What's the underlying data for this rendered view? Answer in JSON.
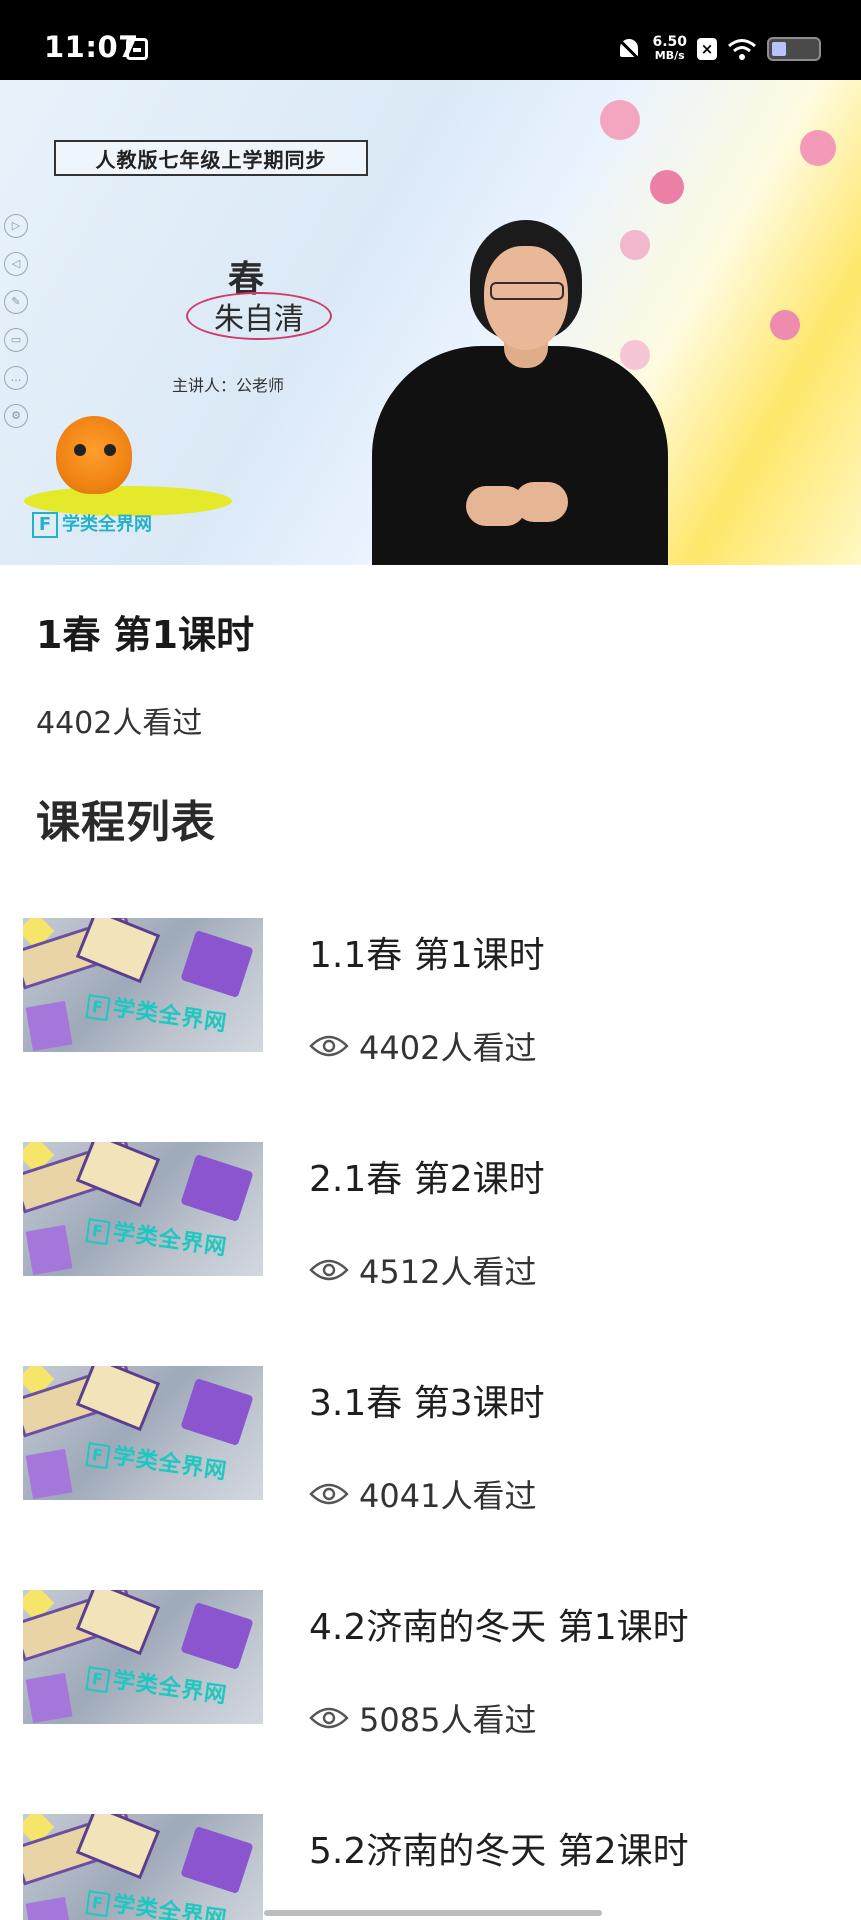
{
  "status_bar": {
    "time": "11:07",
    "net_speed_value": "6.50",
    "net_speed_unit": "MB/s",
    "x_badge": "×",
    "icons": [
      "app-notification-icon",
      "bell-off-icon",
      "x-badge-icon",
      "wifi-icon",
      "battery-icon"
    ]
  },
  "video": {
    "banner": "人教版七年级上学期同步",
    "lesson_title": "春",
    "author": "朱自清",
    "speaker": "主讲人：公老师",
    "logo_text": "学类全界网",
    "side_controls": [
      "▷",
      "◁",
      "✎",
      "▭",
      "…",
      "⚙"
    ]
  },
  "info": {
    "title": "1春 第1课时",
    "views": "4402人看过"
  },
  "course_list": {
    "heading": "课程列表",
    "thumb_brand": "学类全界网",
    "items": [
      {
        "title": "1.1春 第1课时",
        "views": "4402人看过"
      },
      {
        "title": "2.1春 第2课时",
        "views": "4512人看过"
      },
      {
        "title": "3.1春 第3课时",
        "views": "4041人看过"
      },
      {
        "title": "4.2济南的冬天 第1课时",
        "views": "5085人看过"
      },
      {
        "title": "5.2济南的冬天 第2课时",
        "views": ""
      }
    ]
  },
  "colors": {
    "status_bar_bg": "#000000",
    "page_bg": "#ffffff",
    "text_primary": "#1a1a1a",
    "logo_teal": "#27b0c9"
  }
}
